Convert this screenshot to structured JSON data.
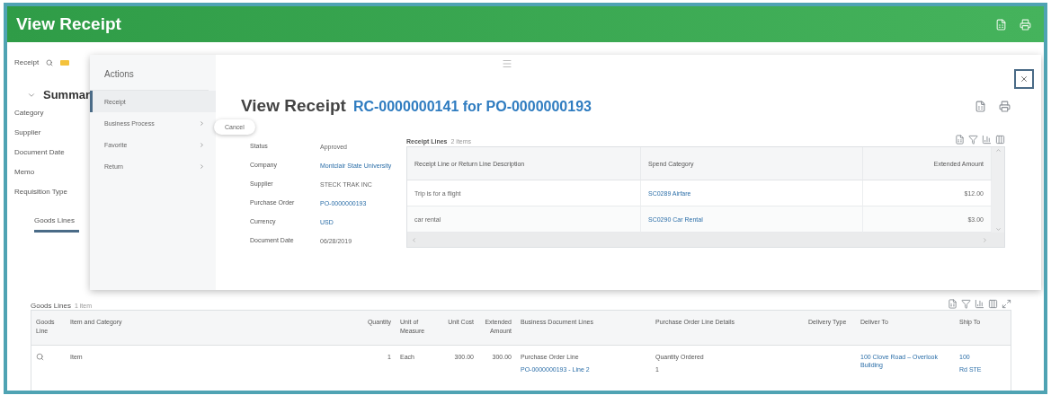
{
  "header": {
    "title": "View Receipt"
  },
  "page": {
    "receipt_label": "Receipt",
    "summary_title": "Summar",
    "summary_fields": [
      "Category",
      "Supplier",
      "Document Date",
      "Memo",
      "Requisition Type"
    ],
    "tabs": [
      {
        "label": "Goods Lines",
        "selected": true
      }
    ]
  },
  "goods_lines": {
    "title": "Goods Lines",
    "count": "1 item",
    "columns": [
      "Goods Line",
      "Item and Category",
      "Quantity",
      "Unit of Measure",
      "Unit Cost",
      "Extended Amount",
      "Business Document Lines",
      "Purchase Order Line Details",
      "Delivery Type",
      "Deliver To",
      "Ship To"
    ],
    "rows": [
      {
        "cells": [
          {
            "kind": "search"
          },
          {
            "kind": "text",
            "lines": [
              {
                "text": "Item",
                "link": false
              }
            ]
          },
          {
            "kind": "text",
            "lines": [
              {
                "text": "1",
                "link": false
              }
            ]
          },
          {
            "kind": "text",
            "lines": [
              {
                "text": "Each",
                "link": false
              }
            ]
          },
          {
            "kind": "text",
            "lines": [
              {
                "text": "300.00",
                "link": false
              }
            ]
          },
          {
            "kind": "text",
            "lines": [
              {
                "text": "300.00",
                "link": false
              }
            ]
          },
          {
            "kind": "text",
            "lines": [
              {
                "text": "Purchase Order Line",
                "link": false
              },
              {
                "text": "PO-0000000193 - Line 2",
                "link": true
              }
            ]
          },
          {
            "kind": "text",
            "lines": [
              {
                "text": "Quantity Ordered",
                "link": false
              },
              {
                "text": "1",
                "link": false
              }
            ]
          },
          {
            "kind": "empty"
          },
          {
            "kind": "text",
            "lines": [
              {
                "text": "100 Clove Road – Overlook Building",
                "link": true
              }
            ]
          },
          {
            "kind": "text",
            "lines": [
              {
                "text": "100",
                "link": true
              },
              {
                "text": "Rd STE",
                "link": true
              }
            ]
          }
        ]
      }
    ]
  },
  "popup": {
    "actions": {
      "title": "Actions",
      "items": [
        {
          "label": "Receipt",
          "selected": true,
          "has_submenu": false
        },
        {
          "label": "Business Process",
          "selected": false,
          "has_submenu": true
        },
        {
          "label": "Favorite",
          "selected": false,
          "has_submenu": true
        },
        {
          "label": "Return",
          "selected": false,
          "has_submenu": true
        }
      ]
    },
    "submenu": [
      "Cancel"
    ],
    "title": "View Receipt",
    "subtitle": "RC-0000000141 for PO-0000000193",
    "fields": [
      {
        "label": "Status",
        "value": "Approved",
        "link": false
      },
      {
        "label": "Company",
        "value": "Montclair State University",
        "link": true
      },
      {
        "label": "Supplier",
        "value": "STECK TRAK INC",
        "link": false
      },
      {
        "label": "Purchase Order",
        "value": "PO-0000000193",
        "link": true
      },
      {
        "label": "Currency",
        "value": "USD",
        "link": true
      },
      {
        "label": "Document Date",
        "value": "06/28/2019",
        "link": false
      }
    ],
    "receipt_lines": {
      "title": "Receipt Lines",
      "count": "2 items",
      "columns": [
        "Receipt Line or Return Line Description",
        "Spend Category",
        "Extended Amount"
      ],
      "rows": [
        {
          "description": "Trip is for a flight",
          "spend_category": "SC0289 Airfare",
          "amount": "$12.00"
        },
        {
          "description": "car rental",
          "spend_category": "SC0290 Car Rental",
          "amount": "$3.00"
        }
      ]
    }
  }
}
